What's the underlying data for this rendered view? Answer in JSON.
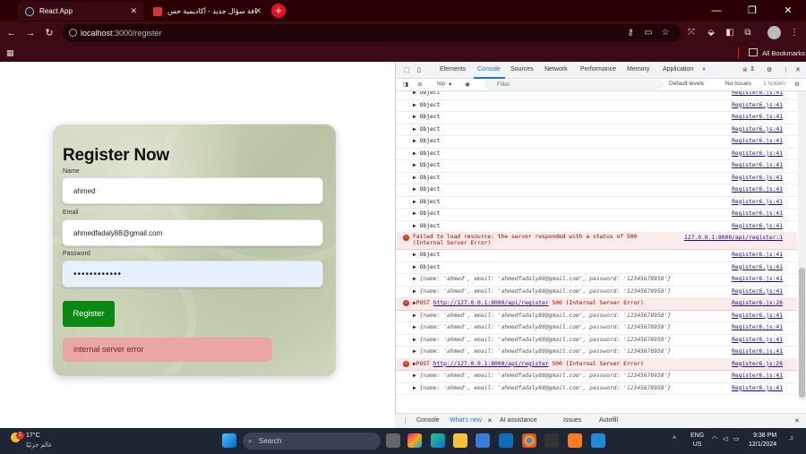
{
  "browser": {
    "tabs": [
      {
        "title": "React App"
      },
      {
        "title": "إضافة سؤال جديد - أكاديمية حس..."
      }
    ],
    "url": {
      "host": "localhost",
      "path": ":3000/register"
    },
    "bookmarks_all": "All Bookmarks"
  },
  "form": {
    "title": "Register Now",
    "name_label": "Name",
    "name_value": "ahmed",
    "email_label": "Email",
    "email_value": "ahmedfadaly88@gmail.com",
    "password_label": "Password",
    "password_value": "••••••••••••",
    "submit": "Register",
    "error": "internal server error"
  },
  "devtools": {
    "tabs": [
      "Elements",
      "Console",
      "Sources",
      "Network",
      "Performance",
      "Memory",
      "Application"
    ],
    "error_count": "3",
    "context": "top",
    "filter_placeholder": "Filter",
    "levels": "Default levels",
    "issues": "No Issues",
    "hidden": "1 hidden",
    "rows": [
      {
        "type": "obj",
        "text": "Object",
        "src": "Register6.js:41"
      },
      {
        "type": "obj",
        "text": "Object",
        "src": "Register6.js:41"
      },
      {
        "type": "obj",
        "text": "Object",
        "src": "Register6.js:41"
      },
      {
        "type": "obj",
        "text": "Object",
        "src": "Register6.js:41"
      },
      {
        "type": "obj",
        "text": "Object",
        "src": "Register6.js:41"
      },
      {
        "type": "obj",
        "text": "Object",
        "src": "Register6.js:41"
      },
      {
        "type": "obj",
        "text": "Object",
        "src": "Register6.js:41"
      },
      {
        "type": "obj",
        "text": "Object",
        "src": "Register6.js:41"
      },
      {
        "type": "obj",
        "text": "Object",
        "src": "Register6.js:41"
      },
      {
        "type": "obj",
        "text": "Object",
        "src": "Register6.js:41"
      },
      {
        "type": "obj",
        "text": "Object",
        "src": "Register6.js:41"
      },
      {
        "type": "obj",
        "text": "Object",
        "src": "Register6.js:41"
      },
      {
        "type": "err",
        "text": "Failed to load resource: the server responded with a status of 500",
        "text2": "(Internal Server Error)",
        "src": "127.0.0.1:8000/api/register:1"
      },
      {
        "type": "obj",
        "text": "Object",
        "src": "Register6.js:41"
      },
      {
        "type": "obj",
        "text": "Object",
        "src": "Register6.js:41"
      },
      {
        "type": "data",
        "text": "{name: 'ahmed', email: 'ahmedfadaly88@gmail.com', password: '12345678958'}",
        "src": "Register6.js:41"
      },
      {
        "type": "data",
        "text": "{name: 'ahmed', email: 'ahmedfadaly88@gmail.com', password: '12345678958'}",
        "src": "Register6.js:41"
      },
      {
        "type": "post",
        "text": "POST",
        "url": "http://127.0.0.1:8000/api/register",
        "status": "500 (Internal Server Error)",
        "src": "Register6.js:26"
      },
      {
        "type": "data",
        "text": "{name: 'ahmed', email: 'ahmedfadaly88@gmail.com', password: '12345678958'}",
        "src": "Register6.js:41"
      },
      {
        "type": "data",
        "text": "{name: 'ahmed', email: 'ahmedfadaly88@gmail.com', password: '12345678958'}",
        "src": "Register6.js:41"
      },
      {
        "type": "data",
        "text": "{name: 'ahmed', email: 'ahmedfadaly88@gmail.com', password: '12345678958'}",
        "src": "Register6.js:41"
      },
      {
        "type": "data",
        "text": "{name: 'ahmed', email: 'ahmedfadaly88@gmail.com', password: '12345678958'}",
        "src": "Register6.js:41"
      },
      {
        "type": "post",
        "text": "POST",
        "url": "http://127.0.0.1:8000/api/register",
        "status": "500 (Internal Server Error)",
        "src": "Register6.js:26"
      },
      {
        "type": "data",
        "text": "{name: 'ahmed', email: 'ahmedfadaly88@gmail.com', password: '12345678958'}",
        "src": "Register6.js:41"
      },
      {
        "type": "data",
        "text": "{name: 'ahmed', email: 'ahmedfadaly88@gmail.com', password: '12345678958'}",
        "src": "Register6.js:41"
      }
    ],
    "drawer_tabs": [
      "Console",
      "What's new",
      "AI assistance",
      "Issues",
      "Autofill"
    ]
  },
  "taskbar": {
    "weather_temp": "17°C",
    "weather_desc": "عالم جزئيًا",
    "search": "Search",
    "lang": "ENG",
    "region": "US",
    "time": "9:38 PM",
    "date": "12/1/2024",
    "notif": "1"
  }
}
